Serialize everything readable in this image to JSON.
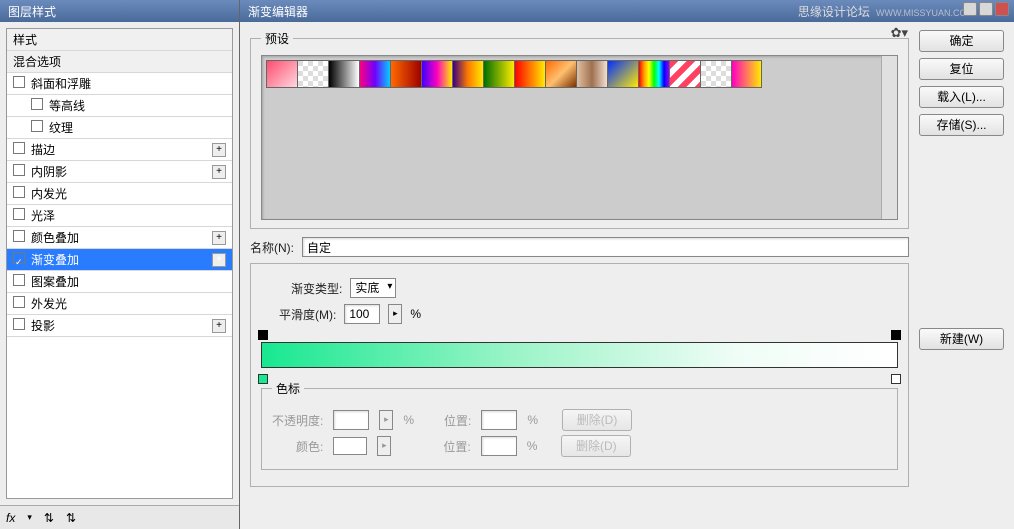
{
  "left_panel": {
    "title": "图层样式",
    "header_styles": "样式",
    "header_blend": "混合选项",
    "items": [
      {
        "label": "斜面和浮雕",
        "checked": false,
        "plus": false,
        "sub": false
      },
      {
        "label": "等高线",
        "checked": false,
        "plus": false,
        "sub": true
      },
      {
        "label": "纹理",
        "checked": false,
        "plus": false,
        "sub": true
      },
      {
        "label": "描边",
        "checked": false,
        "plus": true,
        "sub": false
      },
      {
        "label": "内阴影",
        "checked": false,
        "plus": true,
        "sub": false
      },
      {
        "label": "内发光",
        "checked": false,
        "plus": false,
        "sub": false
      },
      {
        "label": "光泽",
        "checked": false,
        "plus": false,
        "sub": false
      },
      {
        "label": "颜色叠加",
        "checked": false,
        "plus": true,
        "sub": false
      },
      {
        "label": "渐变叠加",
        "checked": true,
        "plus": true,
        "sub": false,
        "selected": true
      },
      {
        "label": "图案叠加",
        "checked": false,
        "plus": false,
        "sub": false
      },
      {
        "label": "外发光",
        "checked": false,
        "plus": false,
        "sub": false
      },
      {
        "label": "投影",
        "checked": false,
        "plus": true,
        "sub": false
      }
    ],
    "footer_fx": "fx",
    "footer_icons": [
      "↕",
      "↕"
    ]
  },
  "right_panel": {
    "title": "渐变编辑器",
    "watermark": "思缘设计论坛",
    "watermark_url": "WWW.MISSYUAN.COM",
    "buttons": {
      "ok": "确定",
      "reset": "复位",
      "load": "载入(L)...",
      "save": "存储(S)...",
      "new": "新建(W)"
    },
    "preset_legend": "预设",
    "gear_icon": "✿▾",
    "swatches": [
      "linear-gradient(135deg,#ff4d6d,#ffd6e0)",
      "repeating-conic-gradient(#fff 0 25%,#ddd 0 50%) 0 0/10px 10px",
      "linear-gradient(90deg,#000,#fff)",
      "linear-gradient(90deg,#ff0080,#7000ff,#00d0ff)",
      "linear-gradient(90deg,#ff6a00,#a00000)",
      "linear-gradient(90deg,#3b00ff,#ff00c0,#ffea00)",
      "linear-gradient(90deg,#3b0080,#ff7a00,#ffea00)",
      "linear-gradient(90deg,#007000,#ffea00)",
      "linear-gradient(90deg,#ff0000,#ffea00)",
      "linear-gradient(135deg,#ff6a00,#ffc070,#7a3000)",
      "linear-gradient(90deg,#e0c0a0,#a07050,#f0e0d0)",
      "linear-gradient(135deg,#0030ff,#ffea00)",
      "linear-gradient(90deg,#ff0000,#ff9900,#ffff00,#00ff00,#00ffff,#0000ff,#9900ff)",
      "repeating-linear-gradient(135deg,#ff4060 0 6px,#fff 6px 12px)",
      "repeating-conic-gradient(#fff 0 25%,#ddd 0 50%) 0 0/10px 10px",
      "linear-gradient(90deg,#ff00c0,#ffea00)"
    ],
    "name_label": "名称(N):",
    "name_value": "自定",
    "type_label": "渐变类型:",
    "type_value": "实底",
    "smooth_label": "平滑度(M):",
    "smooth_value": "100",
    "percent": "%",
    "stops_legend": "色标",
    "opacity_label": "不透明度:",
    "position_label": "位置:",
    "delete_label": "删除(D)",
    "color_label": "颜色:"
  }
}
